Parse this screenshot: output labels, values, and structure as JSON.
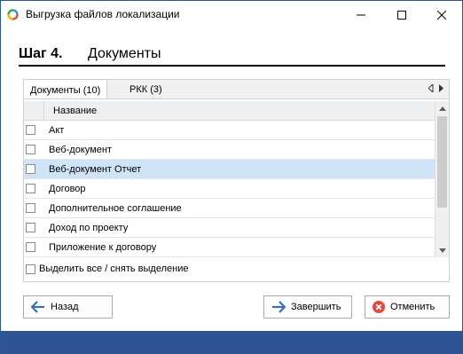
{
  "window": {
    "title": "Выгрузка файлов локализации",
    "accent_color": "#2e5593"
  },
  "step": {
    "number": "Шаг 4.",
    "title": "Документы"
  },
  "tabs": [
    {
      "label": "Документы (10)",
      "active": true
    },
    {
      "label": "РКК (3)",
      "active": false
    }
  ],
  "grid": {
    "column_header": "Название",
    "rows": [
      {
        "label": "Акт",
        "checked": false,
        "selected": false
      },
      {
        "label": "Веб-документ",
        "checked": false,
        "selected": false
      },
      {
        "label": "Веб-документ Отчет",
        "checked": false,
        "selected": true
      },
      {
        "label": "Договор",
        "checked": false,
        "selected": false
      },
      {
        "label": "Дополнительное соглашение",
        "checked": false,
        "selected": false
      },
      {
        "label": "Доход по проекту",
        "checked": false,
        "selected": false
      },
      {
        "label": "Приложение к договору",
        "checked": false,
        "selected": false
      }
    ]
  },
  "select_all_label": "Выделить все / снять выделение",
  "buttons": {
    "back": "Назад",
    "finish": "Завершить",
    "cancel": "Отменить"
  },
  "icons": {
    "back": "arrow-left-icon",
    "finish": "arrow-right-icon",
    "cancel": "cancel-circle-icon"
  }
}
